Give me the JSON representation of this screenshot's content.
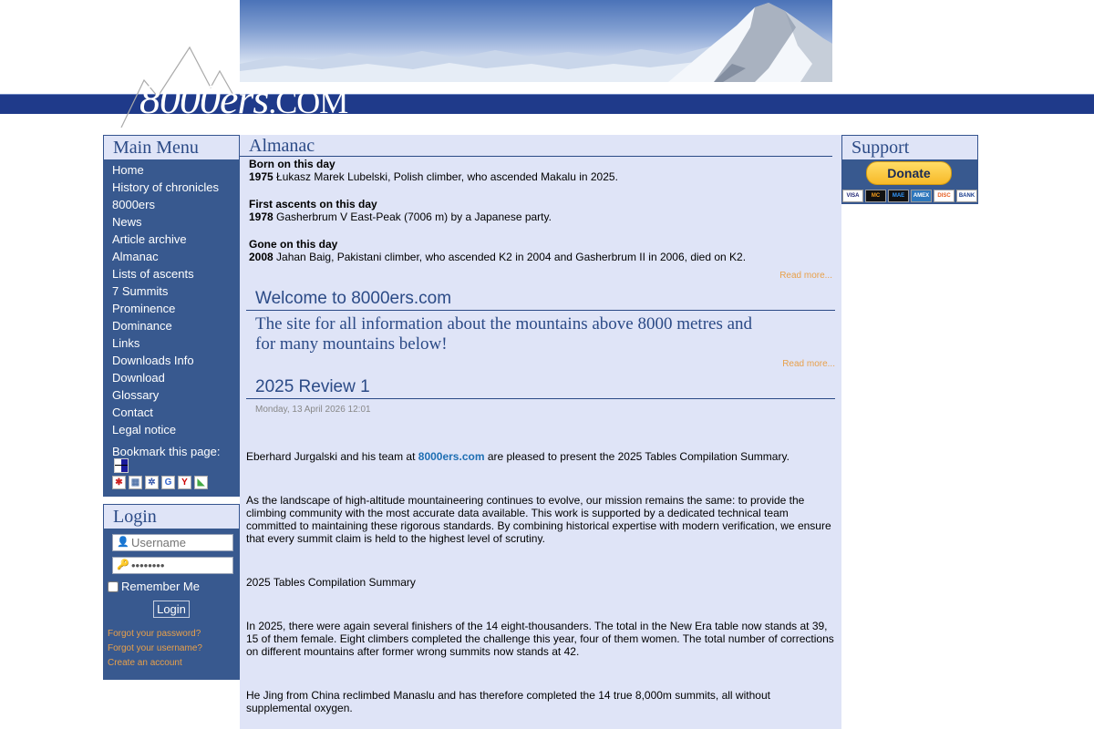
{
  "site": {
    "logo_text": "8000ers",
    "logo_suffix": ".COM"
  },
  "main_menu": {
    "title": "Main Menu",
    "items": [
      "Home",
      "History of chronicles",
      "8000ers",
      "News",
      "Article archive",
      "Almanac",
      "Lists of ascents",
      "7 Summits",
      "Prominence",
      "Dominance",
      "Links",
      "Downloads Info",
      "Download",
      "Glossary",
      "Contact",
      "Legal notice"
    ],
    "bookmark_label": "Bookmark this page:"
  },
  "login": {
    "title": "Login",
    "username_placeholder": "Username",
    "password_value": "••••••••",
    "remember_label": "Remember Me",
    "button_label": "Login",
    "links": [
      "Forgot your password?",
      "Forgot your username?",
      "Create an account"
    ]
  },
  "almanac": {
    "title": "Almanac",
    "born_heading": "Born on this day",
    "born_year": "1975",
    "born_text": " Łukasz Marek Lubelski, Polish climber, who ascended Makalu in 2025.",
    "first_heading": "First ascents on this day",
    "first_year": "1978",
    "first_text": " Gasherbrum V East-Peak (7006 m) by a Japanese party.",
    "gone_heading": "Gone on this day",
    "gone_year": "2008",
    "gone_text": " Jahan Baig, Pakistani climber, who ascended K2 in 2004 and Gasherbrum II in 2006, died on K2.",
    "read_more": "Read more..."
  },
  "welcome": {
    "title": "Welcome to 8000ers.com",
    "intro": "The site for all information about the mountains above 8000 metres and for many mountains below!",
    "read_more": "Read more..."
  },
  "article": {
    "title": "2025 Review 1",
    "date": "Monday, 13 April 2026 12:01",
    "p1_before": "Eberhard Jurgalski and his team at ",
    "p1_link": "8000ers.com",
    "p1_after": " are pleased to present the 2025 Tables Compilation Summary.",
    "p2": "As the landscape of high-altitude mountaineering continues to evolve, our mission remains the same: to provide the climbing community with the most accurate data available. This work is supported by a dedicated technical team committed to maintaining these rigorous standards. By combining historical expertise with modern verification, we ensure that every summit claim is held to the highest level of scrutiny.",
    "p3": "2025 Tables Compilation Summary",
    "p4": "In 2025, there were again several finishers of the 14 eight-thousanders. The total in the New Era table now stands at 39, 15 of them female. Eight climbers completed the challenge this year, four of them women. The total number of corrections on different mountains after former wrong summits now stands at 42.",
    "p5": "He Jing from China reclimbed Manaslu and has therefore completed the 14 true 8,000m summits, all without supplemental oxygen."
  },
  "support": {
    "title": "Support",
    "donate_label": "Donate",
    "cards": [
      "VISA",
      "MC",
      "MAE",
      "AMEX",
      "DISC",
      "BANK"
    ]
  },
  "colors": {
    "brand_blue": "#1f3a8a",
    "menu_blue": "#38598f",
    "panel_bg": "#dfe4f7",
    "link_orange": "#e8a04a"
  }
}
